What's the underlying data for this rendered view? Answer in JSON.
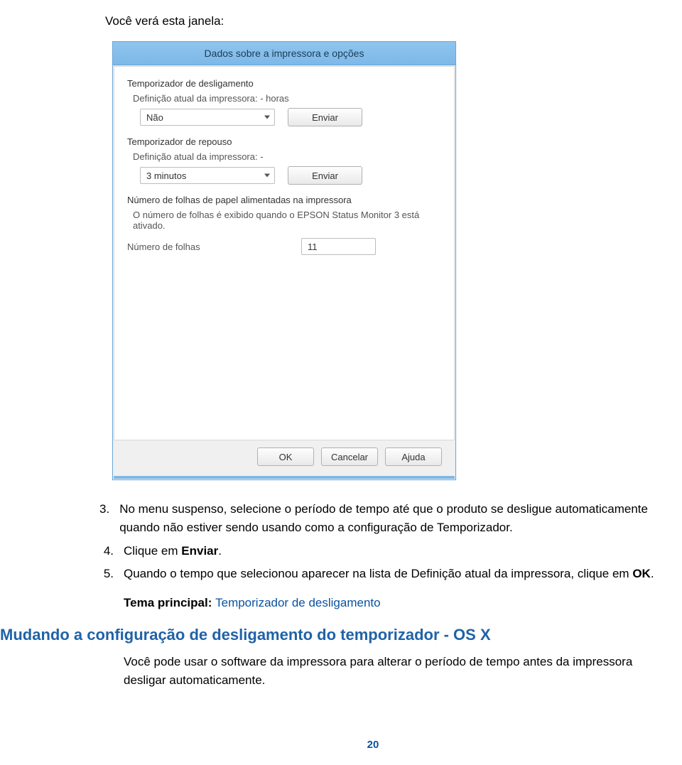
{
  "doc": {
    "intro": "Você verá esta janela:",
    "window_title": "Dados sobre a impressora e opções",
    "group1": {
      "title": "Temporizador de desligamento",
      "current": "Definição atual da impressora: - horas",
      "select_value": "Não",
      "send_label": "Enviar"
    },
    "group2": {
      "title": "Temporizador de repouso",
      "current": "Definição atual da impressora: -",
      "select_value": "3 minutos",
      "send_label": "Enviar"
    },
    "group3": {
      "title": "Número de folhas de papel alimentadas na impressora",
      "note": "O número de folhas é exibido quando o EPSON Status Monitor 3 está ativado.",
      "count_label": "Número de folhas",
      "count_value": "11"
    },
    "buttons": {
      "ok": "OK",
      "cancel": "Cancelar",
      "help": "Ajuda"
    },
    "steps": {
      "s3_num": "3.",
      "s3_text_a": "No menu suspenso, selecione o período de tempo até que o produto se desligue automaticamente quando não estiver sendo usando como a configuração de Temporizador.",
      "s4_num": "4.",
      "s4_text_a": "Clique em ",
      "s4_text_b": "Enviar",
      "s4_text_c": ".",
      "s5_num": "5.",
      "s5_text_a": "Quando o tempo que selecionou aparecer na lista de Definição atual da impressora, clique em ",
      "s5_text_b": "OK",
      "s5_text_c": "."
    },
    "tema_label": "Tema principal: ",
    "tema_link": "Temporizador de desligamento",
    "heading": "Mudando a configuração de desligamento do temporizador - OS X",
    "body": "Você pode usar o software da impressora para alterar o período de tempo antes da impressora desligar automaticamente.",
    "page_number": "20"
  }
}
